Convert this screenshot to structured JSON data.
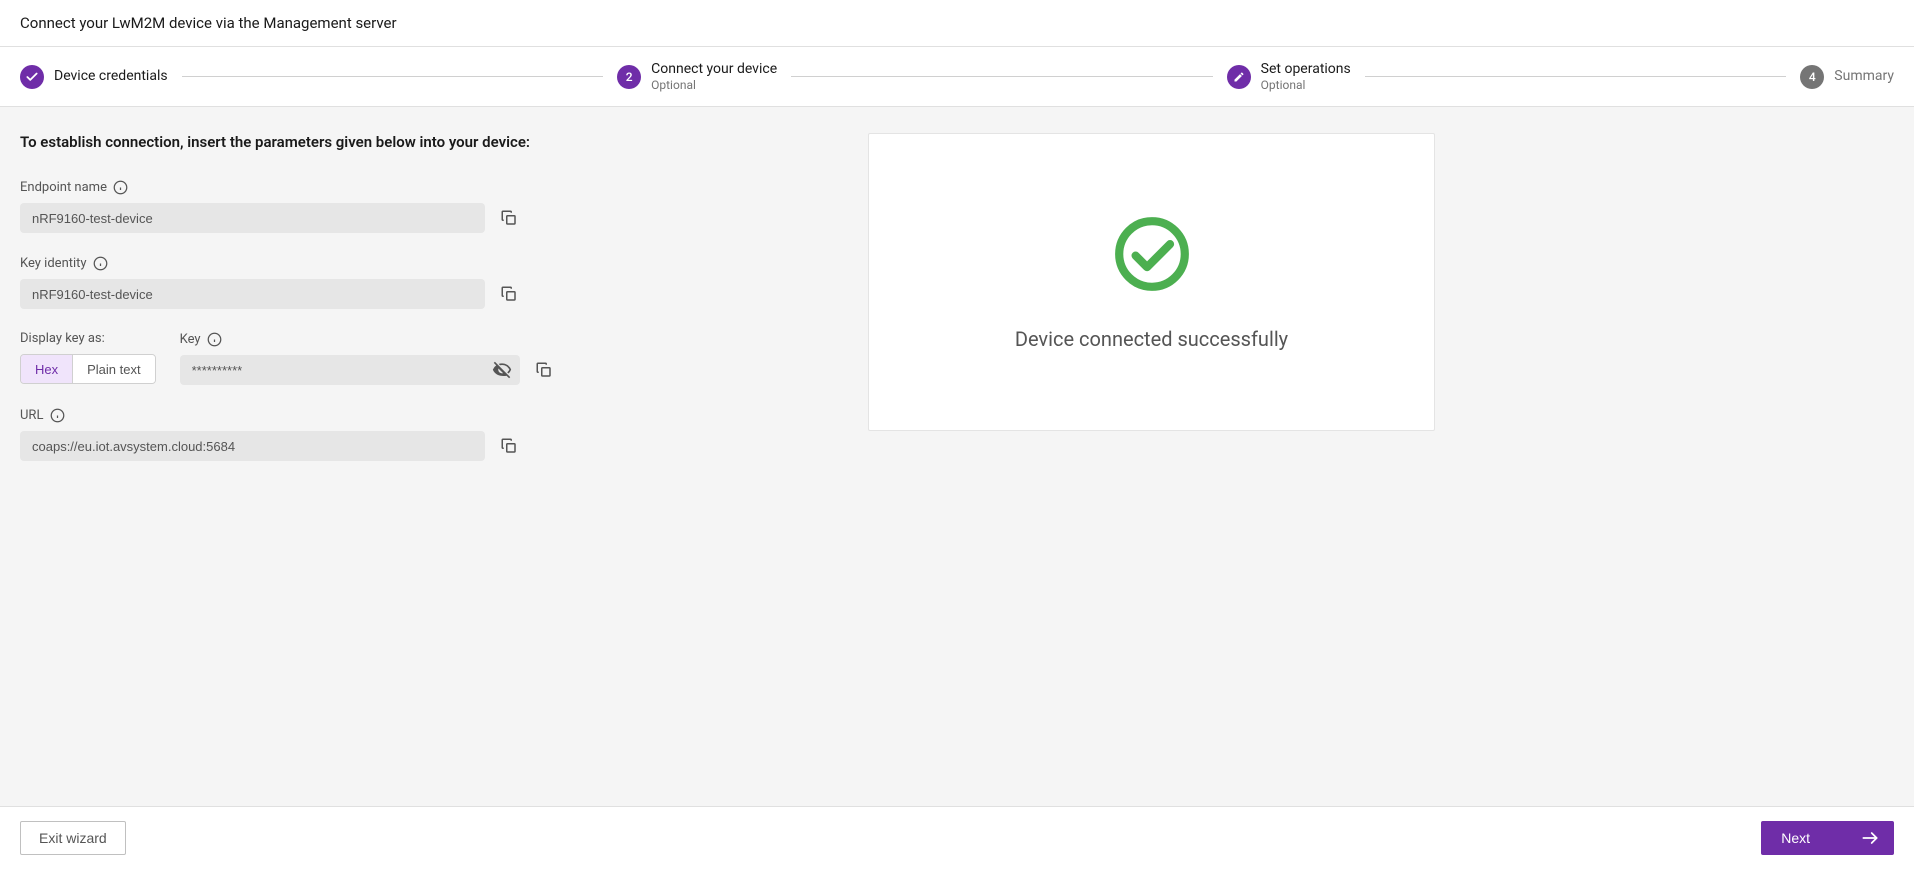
{
  "header": {
    "title": "Connect your LwM2M device via the Management server"
  },
  "stepper": {
    "steps": [
      {
        "label": "Device credentials",
        "sub": "",
        "state": "done",
        "marker": "check"
      },
      {
        "label": "Connect your device",
        "sub": "Optional",
        "state": "active",
        "marker": "2"
      },
      {
        "label": "Set operations",
        "sub": "Optional",
        "state": "done",
        "marker": "pencil"
      },
      {
        "label": "Summary",
        "sub": "",
        "state": "pending",
        "marker": "4"
      }
    ]
  },
  "main": {
    "instruction": "To establish connection, insert the parameters given below into your device:",
    "fields": {
      "endpoint": {
        "label": "Endpoint name",
        "value": "nRF9160-test-device"
      },
      "keyIdentity": {
        "label": "Key identity",
        "value": "nRF9160-test-device"
      },
      "displayKeyAs": {
        "label": "Display key as:",
        "options": [
          "Hex",
          "Plain text"
        ],
        "selected": "Hex"
      },
      "key": {
        "label": "Key",
        "value": "**********"
      },
      "url": {
        "label": "URL",
        "value": "coaps://eu.iot.avsystem.cloud:5684"
      }
    },
    "status": {
      "message": "Device connected successfully"
    }
  },
  "footer": {
    "exit": "Exit wizard",
    "next": "Next"
  },
  "colors": {
    "accent": "#6f2da8",
    "success": "#4caf50"
  }
}
